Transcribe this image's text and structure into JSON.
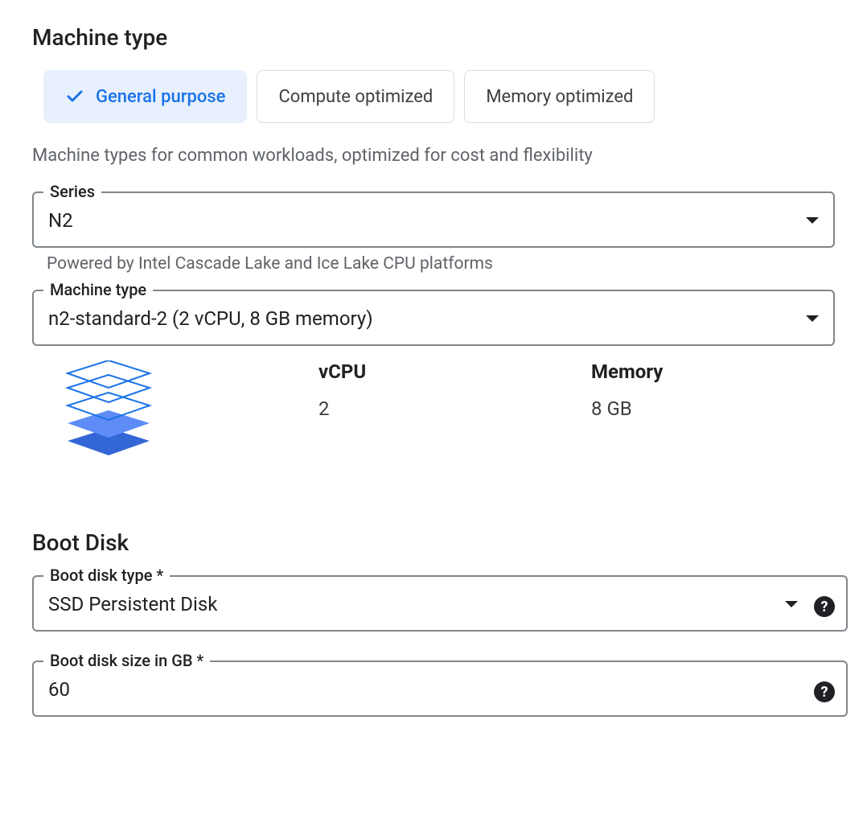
{
  "machineType": {
    "heading": "Machine type",
    "tabs": [
      {
        "label": "General purpose",
        "active": true
      },
      {
        "label": "Compute optimized",
        "active": false
      },
      {
        "label": "Memory optimized",
        "active": false
      }
    ],
    "description": "Machine types for common workloads, optimized for cost and flexibility",
    "series": {
      "label": "Series",
      "value": "N2",
      "helper": "Powered by Intel Cascade Lake and Ice Lake CPU platforms"
    },
    "type": {
      "label": "Machine type",
      "value": "n2-standard-2 (2 vCPU, 8 GB memory)"
    },
    "specs": {
      "vcpu_label": "vCPU",
      "vcpu_value": "2",
      "memory_label": "Memory",
      "memory_value": "8 GB"
    }
  },
  "bootDisk": {
    "heading": "Boot Disk",
    "diskType": {
      "label": "Boot disk type *",
      "value": "SSD Persistent Disk"
    },
    "diskSize": {
      "label": "Boot disk size in GB *",
      "value": "60"
    }
  }
}
